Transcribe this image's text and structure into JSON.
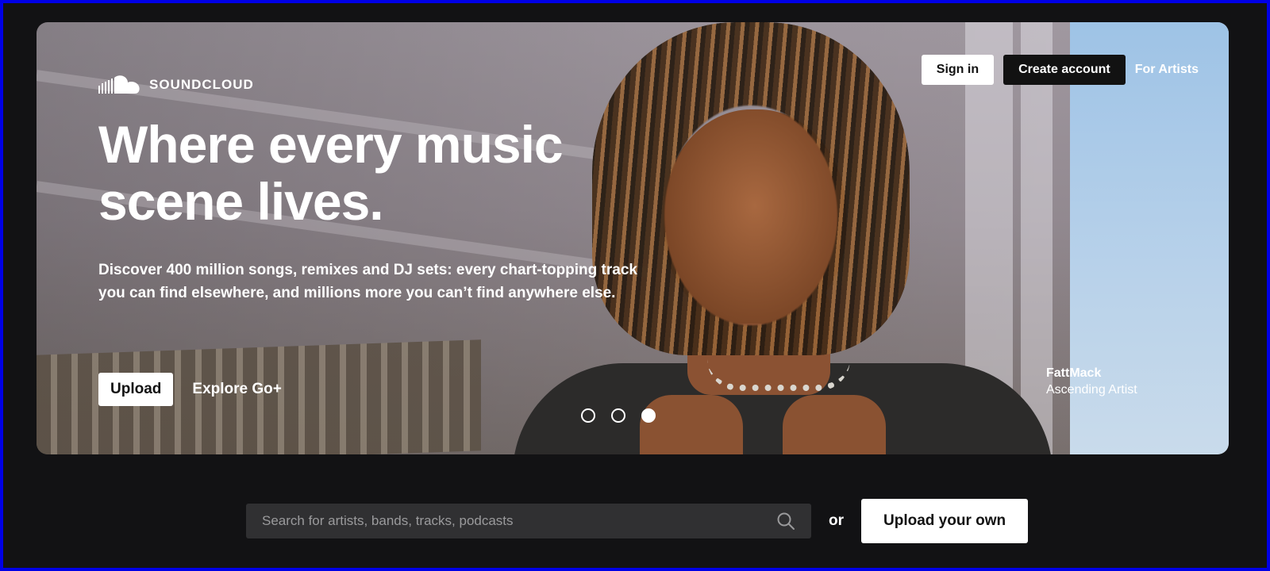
{
  "brand": {
    "name": "SOUNDCLOUD",
    "logo_icon": "soundcloud-cloud-icon"
  },
  "header": {
    "sign_in_label": "Sign in",
    "create_account_label": "Create account",
    "for_artists_label": "For Artists"
  },
  "hero": {
    "headline": "Where every music scene lives.",
    "subtext": "Discover 400 million songs, remixes and DJ sets: every chart-topping track you can find elsewhere, and millions more you can’t find anywhere else.",
    "upload_label": "Upload",
    "explore_label": "Explore Go+",
    "carousel": {
      "slides": 3,
      "active_index": 2
    },
    "credit": {
      "name": "FattMack",
      "title": "Ascending Artist"
    }
  },
  "search": {
    "placeholder": "Search for artists, bands, tracks, podcasts",
    "value": "",
    "icon": "search-icon",
    "or_label": "or",
    "upload_own_label": "Upload your own"
  },
  "colors": {
    "page_background": "#121214",
    "frame_border": "#0000e6",
    "button_white": "#ffffff",
    "button_dark": "#121212",
    "search_background": "#303032"
  }
}
